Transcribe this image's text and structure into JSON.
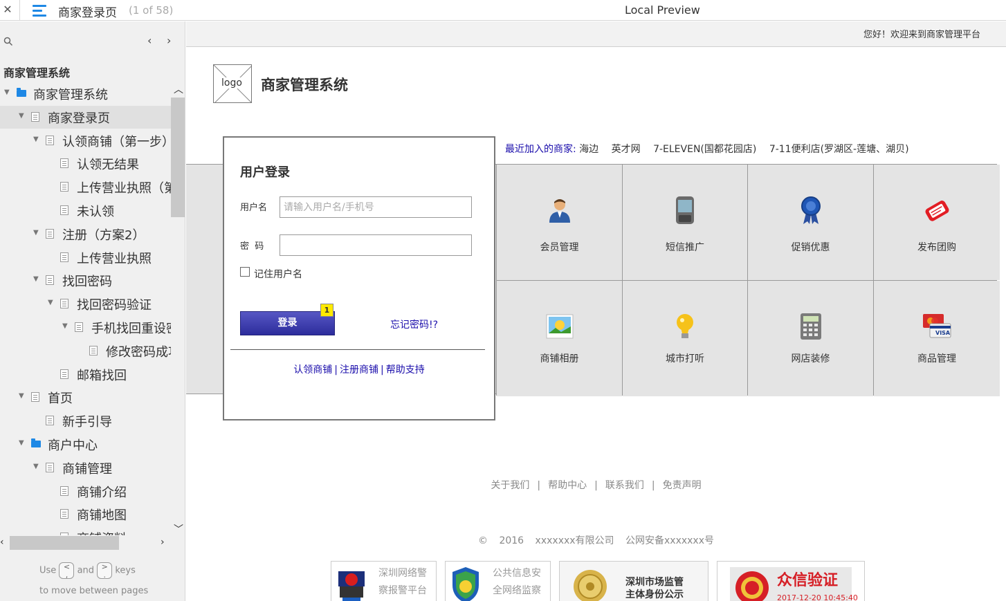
{
  "topbar": {
    "close_icon": "close-icon",
    "menu_icon": "hamburger-menu-icon",
    "page_name": "商家登录页",
    "page_count": "(1 of 58)",
    "preview_title": "Local Preview"
  },
  "sidebar": {
    "search_icon": "search-icon",
    "prev_glyph": "‹",
    "next_glyph": "›",
    "project_title": "商家管理系统",
    "tree": [
      {
        "label": "商家管理系统",
        "level": 0,
        "icon": "folder",
        "toggle": "▼"
      },
      {
        "label": "商家登录页",
        "level": 1,
        "icon": "page",
        "toggle": "▼",
        "selected": true
      },
      {
        "label": "认领商铺（第一步）",
        "level": 2,
        "icon": "page",
        "toggle": "▼"
      },
      {
        "label": "认领无结果",
        "level": 3,
        "icon": "page",
        "toggle": ""
      },
      {
        "label": "上传营业执照（第",
        "level": 3,
        "icon": "page",
        "toggle": ""
      },
      {
        "label": "未认领",
        "level": 3,
        "icon": "page",
        "toggle": ""
      },
      {
        "label": "注册（方案2）",
        "level": 2,
        "icon": "page",
        "toggle": "▼"
      },
      {
        "label": "上传营业执照",
        "level": 3,
        "icon": "page",
        "toggle": ""
      },
      {
        "label": "找回密码",
        "level": 2,
        "icon": "page",
        "toggle": "▼"
      },
      {
        "label": "找回密码验证",
        "level": 3,
        "icon": "page",
        "toggle": "▼"
      },
      {
        "label": "手机找回重设密",
        "level": 4,
        "icon": "page",
        "toggle": "▼"
      },
      {
        "label": "修改密码成功",
        "level": 5,
        "icon": "page",
        "toggle": ""
      },
      {
        "label": "邮箱找回",
        "level": 3,
        "icon": "page",
        "toggle": ""
      },
      {
        "label": "首页",
        "level": 1,
        "icon": "page",
        "toggle": "▼"
      },
      {
        "label": "新手引导",
        "level": 2,
        "icon": "page",
        "toggle": ""
      },
      {
        "label": "商户中心",
        "level": 1,
        "icon": "folder",
        "toggle": "▼"
      },
      {
        "label": "商铺管理",
        "level": 2,
        "icon": "page",
        "toggle": "▼"
      },
      {
        "label": "商铺介绍",
        "level": 3,
        "icon": "page",
        "toggle": ""
      },
      {
        "label": "商铺地图",
        "level": 3,
        "icon": "page",
        "toggle": ""
      },
      {
        "label": "商铺资料",
        "level": 3,
        "icon": "page",
        "toggle": ""
      }
    ],
    "hint": {
      "use": "Use",
      "key_prev": "<\n,",
      "and": "and",
      "key_next": ">\n.",
      "keys": "keys",
      "line2": "to move between pages"
    }
  },
  "main": {
    "welcome": "您好！欢迎来到商家管理平台",
    "logo_text": "logo",
    "system_title": "商家管理系统",
    "login": {
      "title": "用户登录",
      "username_label": "用户名",
      "username_placeholder": "请输入用户名/手机号",
      "password_label": "密  码",
      "password_value": "",
      "remember_label": "记住用户名",
      "remember_checked": false,
      "login_button": "登录",
      "note_badge": "1",
      "forgot_link": "忘记密码!?",
      "links": [
        "认领商铺",
        "注册商铺",
        "帮助支持"
      ],
      "link_separator": "|"
    },
    "recent": {
      "label": "最近加入的商家:",
      "shops": [
        "海边",
        "英才网",
        "7-ELEVEN(国都花园店)",
        "7-11便利店(罗湖区-莲塘、湖贝)"
      ]
    },
    "features": [
      {
        "label": "会员管理",
        "icon": "member-person-icon"
      },
      {
        "label": "短信推广",
        "icon": "mobile-phone-icon"
      },
      {
        "label": "促销优惠",
        "icon": "award-ribbon-icon"
      },
      {
        "label": "发布团购",
        "icon": "red-tag-icon"
      },
      {
        "label": "商铺相册",
        "icon": "photo-album-icon"
      },
      {
        "label": "城市打听",
        "icon": "lightbulb-icon"
      },
      {
        "label": "网店装修",
        "icon": "calculator-icon"
      },
      {
        "label": "商品管理",
        "icon": "credit-card-icon"
      }
    ],
    "footer_links": [
      "关于我们",
      "帮助中心",
      "联系我们",
      "免责声明"
    ],
    "footer_separator": "|",
    "copyright": [
      "©",
      "2016",
      "xxxxxxx有限公司",
      "公网安备xxxxxxx号"
    ],
    "badges": [
      {
        "line1": "深圳网络警",
        "line2": "察报警平台",
        "icon": "police-badge-icon"
      },
      {
        "line1": "公共信息安",
        "line2": "全网络监察",
        "icon": "security-shield-icon"
      },
      {
        "line1": "深圳市场监管",
        "line2": "主体身份公示",
        "icon": "gold-seal-icon"
      },
      {
        "line1": "众信验证",
        "line2": "2017-12-20 10:45:40",
        "icon": "ebs-red-seal-icon"
      }
    ]
  }
}
